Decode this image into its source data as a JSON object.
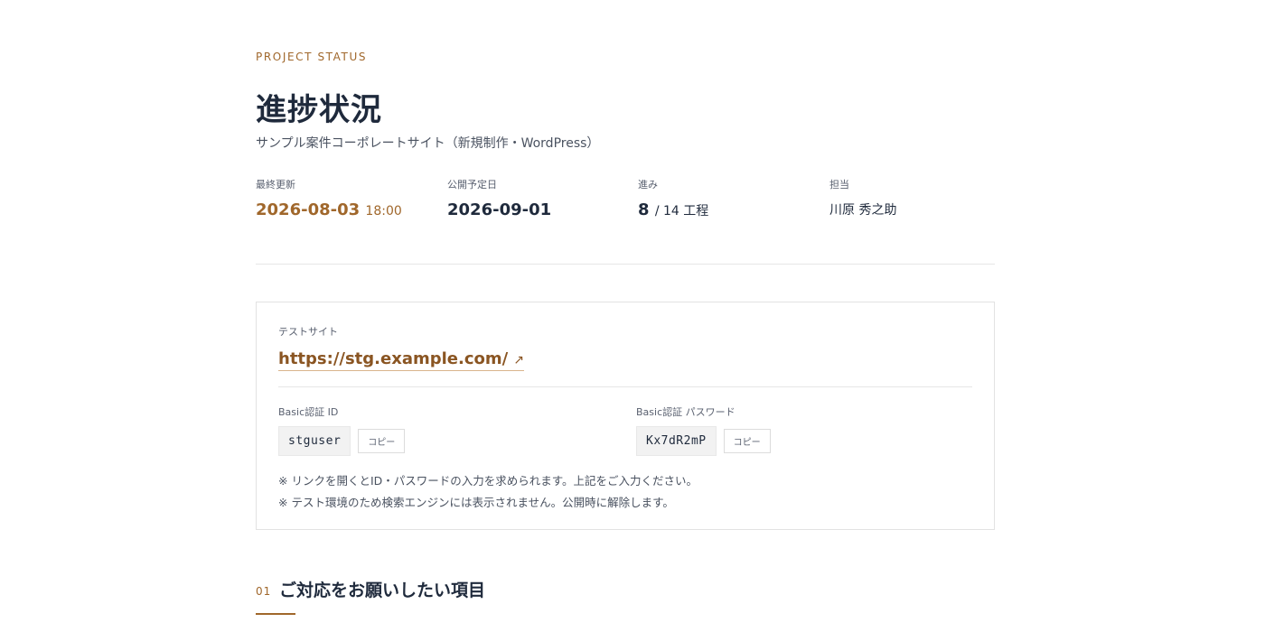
{
  "header": {
    "eyebrow": "PROJECT STATUS",
    "title": "進捗状況",
    "subtitle": "サンプル案件コーポレートサイト（新規制作・WordPress）"
  },
  "meta": {
    "updated": {
      "label": "最終更新",
      "date": "2026-08-03",
      "time": "18:00"
    },
    "publish": {
      "label": "公開予定日",
      "date": "2026-09-01"
    },
    "progress": {
      "label": "進み",
      "current": "8",
      "total": "/ 14 工程"
    },
    "owner": {
      "label": "担当",
      "name": "川原 秀之助"
    }
  },
  "test_site": {
    "label": "テストサイト",
    "url": "https://stg.example.com/",
    "external_icon": "↗",
    "basic_id": {
      "label": "Basic認証 ID",
      "value": "stguser",
      "copy_label": "コピー"
    },
    "basic_password": {
      "label": "Basic認証 パスワード",
      "value": "Kx7dR2mP",
      "copy_label": "コピー"
    },
    "notes": [
      "※ リンクを開くとID・パスワードの入力を求められます。上記をご入力ください。",
      "※ テスト環境のため検索エンジンには表示されません。公開時に解除します。"
    ]
  },
  "section": {
    "number": "01",
    "title": "ご対応をお願いしたい項目"
  },
  "colors": {
    "accent": "#a0672b",
    "link": "#8a5522",
    "heading": "#1f2a3c"
  }
}
